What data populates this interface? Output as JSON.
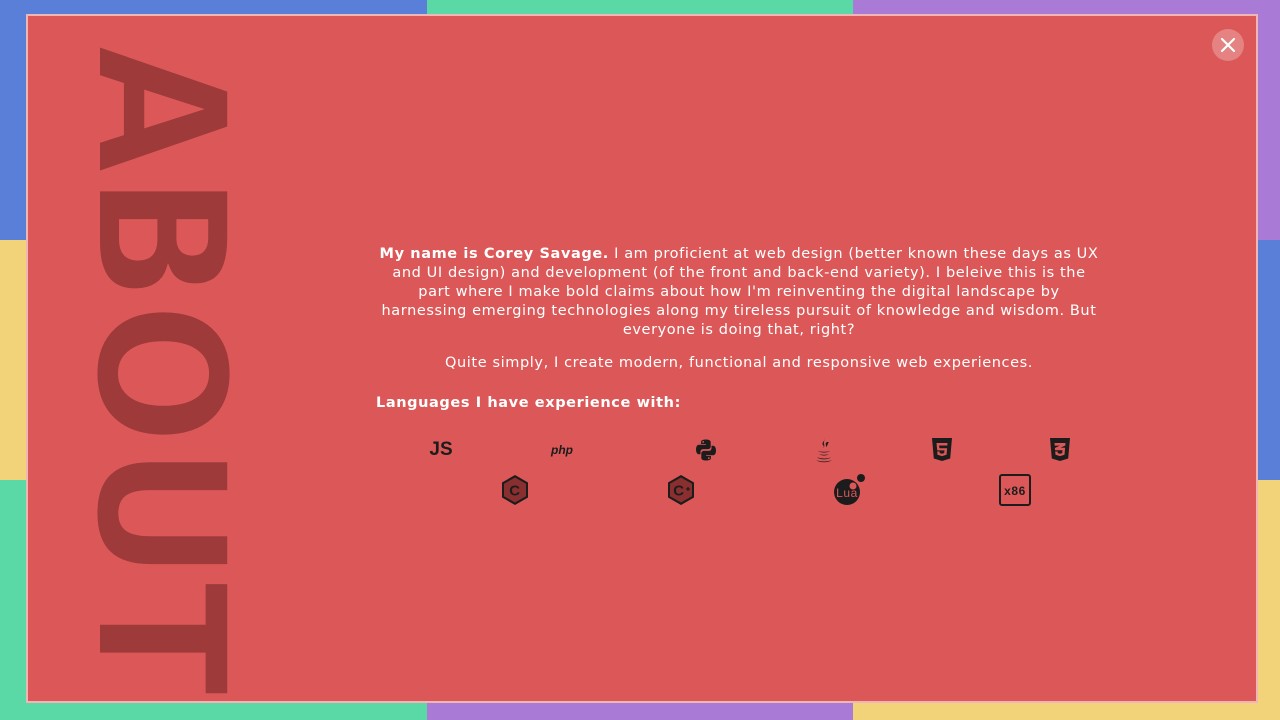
{
  "modal": {
    "section_title": "ABOUT",
    "close_label": "×",
    "intro_name": "My name is Corey Savage.",
    "intro_rest": " I am proficient at web design (better known these days as UX and UI design) and development (of the front and back-end variety). I beleive this is the part where I make bold claims about how I'm reinventing the digital landscape by harnessing emerging technologies along my tireless pursuit of knowledge and wisdom. But everyone is doing that, right?",
    "tagline": "Quite simply, I create modern, functional and responsive web experiences.",
    "languages_title": "Languages I have experience with:",
    "languages": [
      {
        "name": "javascript-icon",
        "label": "JS"
      },
      {
        "name": "php-icon",
        "label": "php"
      },
      {
        "name": "python-icon",
        "label": ""
      },
      {
        "name": "java-icon",
        "label": ""
      },
      {
        "name": "html5-icon",
        "label": "5"
      },
      {
        "name": "css3-icon",
        "label": "3"
      },
      {
        "name": "c-icon",
        "label": "C"
      },
      {
        "name": "cplusplus-icon",
        "label": "C"
      },
      {
        "name": "lua-icon",
        "label": "Lua"
      },
      {
        "name": "x86-icon",
        "label": "x86"
      }
    ]
  },
  "colors": {
    "modal_bg": "#dc5858",
    "big_word": "#9e3a3a",
    "tile_blue": "#5a7fd9",
    "tile_green": "#5ad9a6",
    "tile_purple": "#a97ad6",
    "tile_yellow": "#f2d37a"
  }
}
